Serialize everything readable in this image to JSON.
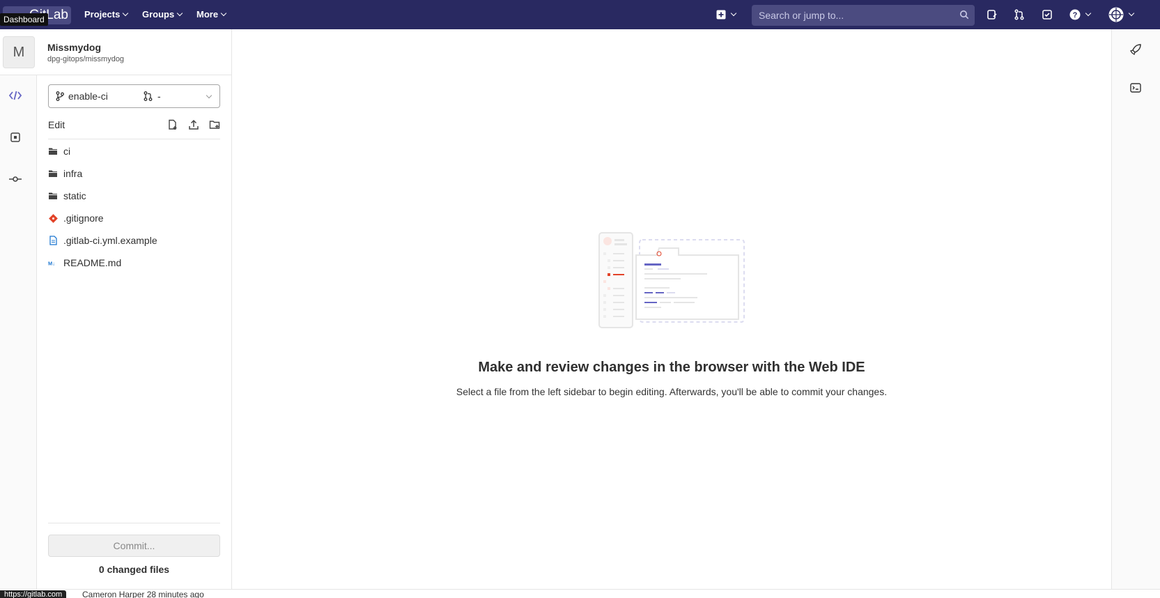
{
  "navbar": {
    "tooltip": "Dashboard",
    "logo_text": "GitLab",
    "projects": "Projects",
    "groups": "Groups",
    "more": "More",
    "search_placeholder": "Search or jump to..."
  },
  "project": {
    "avatar_letter": "M",
    "name": "Missmydog",
    "path": "dpg-gitops/missmydog"
  },
  "branch": {
    "name": "enable-ci",
    "merge_request": "-"
  },
  "edit_label": "Edit",
  "tree": [
    {
      "name": "ci",
      "icon": "folder-icon"
    },
    {
      "name": "infra",
      "icon": "folder-icon"
    },
    {
      "name": "static",
      "icon": "folder-icon"
    },
    {
      "name": ".gitignore",
      "icon": "git-icon"
    },
    {
      "name": ".gitlab-ci.yml.example",
      "icon": "file-icon"
    },
    {
      "name": "README.md",
      "icon": "markdown-icon"
    }
  ],
  "commit": {
    "button": "Commit...",
    "changed": "0 changed files"
  },
  "empty_state": {
    "title": "Make and review changes in the browser with the Web IDE",
    "description": "Select a file from the left sidebar to begin editing. Afterwards, you'll be able to commit your changes."
  },
  "status": {
    "url": "https://gitlab.com",
    "text": "Cameron Harper 28 minutes ago"
  },
  "colors": {
    "navbar": "#292961",
    "accent": "#6666c4",
    "orange": "#e24329"
  }
}
